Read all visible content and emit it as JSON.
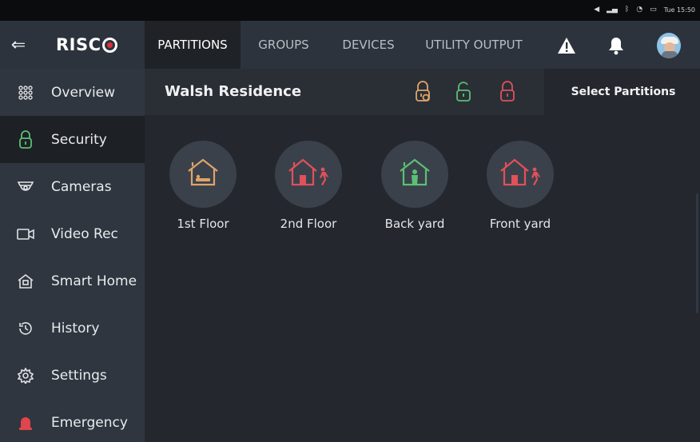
{
  "status_bar": {
    "time": "Tue 15:50",
    "icons": [
      "volume-icon",
      "signal-icon",
      "bluetooth-icon",
      "wifi-icon",
      "battery-icon"
    ]
  },
  "app": {
    "logo_text": "RISC",
    "brand_red": "#d9333c"
  },
  "sidebar": {
    "items": [
      {
        "label": "Overview",
        "icon": "grid-icon"
      },
      {
        "label": "Security",
        "icon": "lock-icon",
        "active": true
      },
      {
        "label": "Cameras",
        "icon": "camera-icon"
      },
      {
        "label": "Video Rec",
        "icon": "video-icon"
      },
      {
        "label": "Smart Home",
        "icon": "home-icon"
      },
      {
        "label": "History",
        "icon": "history-icon"
      },
      {
        "label": "Settings",
        "icon": "gear-icon"
      },
      {
        "label": "Emergency",
        "icon": "siren-icon"
      }
    ]
  },
  "tabs": [
    {
      "label": "PARTITIONS",
      "active": true
    },
    {
      "label": "GROUPS"
    },
    {
      "label": "DEVICES"
    },
    {
      "label": "UTILITY OUTPUT"
    }
  ],
  "header": {
    "title": "Walsh Residence",
    "select_label": "Select Partitions",
    "lock_colors": {
      "partial": "#e0a46a",
      "disarmed": "#5cbf73",
      "armed": "#e0515a"
    }
  },
  "partitions": [
    {
      "label": "1st Floor",
      "state_color": "#e0a46a",
      "icon": "house-bed-icon"
    },
    {
      "label": "2nd Floor",
      "state_color": "#e0515a",
      "icon": "house-away-icon"
    },
    {
      "label": "Back yard",
      "state_color": "#5cbf73",
      "icon": "house-person-icon"
    },
    {
      "label": "Front yard",
      "state_color": "#e0515a",
      "icon": "house-away-icon"
    }
  ]
}
